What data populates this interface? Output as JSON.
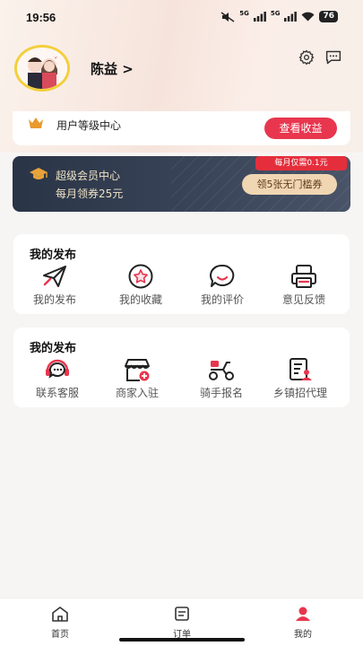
{
  "status_bar": {
    "time": "19:56",
    "signal1": "5G",
    "signal2": "5G",
    "battery": "76"
  },
  "profile": {
    "username": "陈益 >"
  },
  "header_icons": [
    "gear-icon",
    "chat-bubble-icon"
  ],
  "level_card": {
    "label": "用户等级中心",
    "button": "查看收益"
  },
  "vip_card": {
    "title": "超级会员中心",
    "subtitle": "每月领券25元",
    "tag": "每月仅需0.1元",
    "button": "领5张无门槛券"
  },
  "section1": {
    "title": "我的发布",
    "items": [
      {
        "label": "我的发布",
        "icon": "paper-plane-icon"
      },
      {
        "label": "我的收藏",
        "icon": "star-icon"
      },
      {
        "label": "我的评价",
        "icon": "smile-bubble-icon"
      },
      {
        "label": "意见反馈",
        "icon": "printer-icon"
      }
    ]
  },
  "section2": {
    "title": "我的发布",
    "items": [
      {
        "label": "联系客服",
        "icon": "headset-icon"
      },
      {
        "label": "商家入驻",
        "icon": "store-icon"
      },
      {
        "label": "骑手报名",
        "icon": "scooter-icon"
      },
      {
        "label": "乡镇招代理",
        "icon": "document-user-icon"
      }
    ]
  },
  "tabbar": {
    "tabs": [
      {
        "label": "首页",
        "icon": "home-icon"
      },
      {
        "label": "订单",
        "icon": "order-icon"
      },
      {
        "label": "我的",
        "icon": "user-icon",
        "active": true
      }
    ]
  },
  "colors": {
    "accent": "#e8364e",
    "gold": "#f3cf3b",
    "vip_dark": "#2a3447",
    "coupon": "#f1d6b3"
  }
}
